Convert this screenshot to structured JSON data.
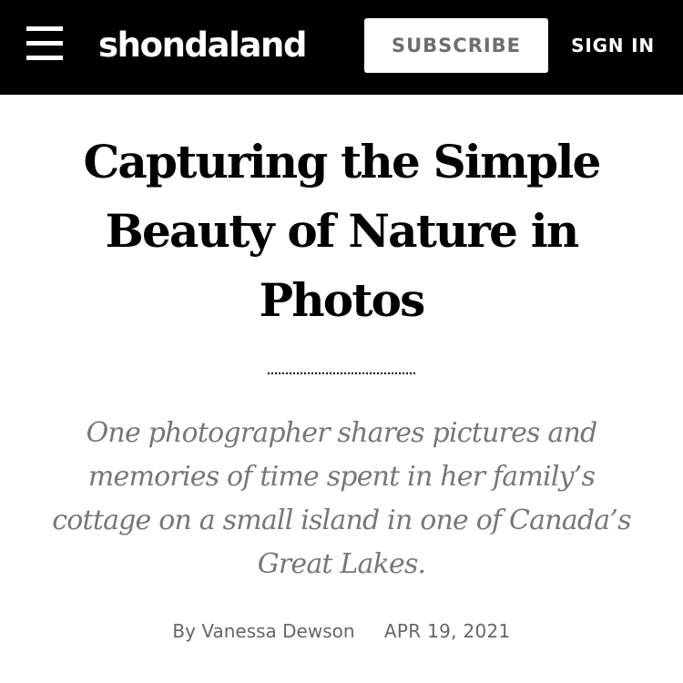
{
  "header": {
    "logo": "shondaland",
    "subscribe_label": "SUBSCRIBE",
    "signin_label": "SIGN IN",
    "menu_icon": "hamburger-menu-icon",
    "background_color": "#000000"
  },
  "article": {
    "title": "Capturing the Simple Beauty of Nature in Photos",
    "dek": "One photographer shares pictures and memories of time spent in her family’s cottage on a small island in one of Canada’s Great Lakes.",
    "byline_prefix": "By",
    "author": "Vanessa Dewson",
    "date": "APR 19, 2021"
  }
}
